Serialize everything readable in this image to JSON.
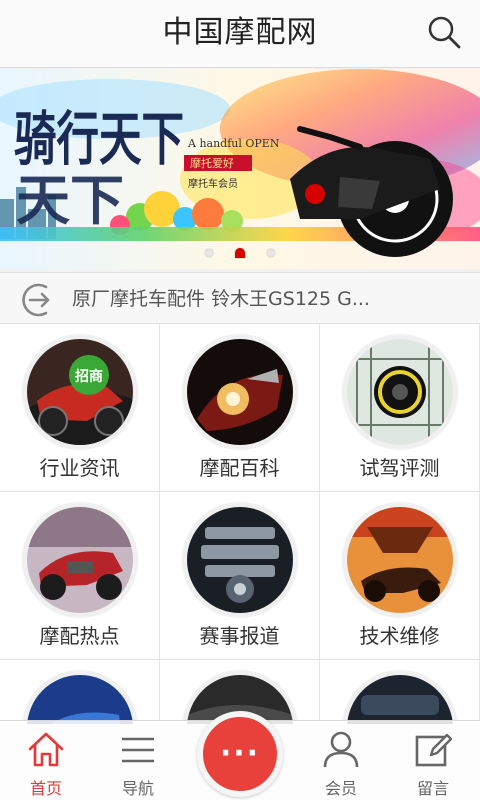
{
  "header": {
    "title": "中国摩配网",
    "search_icon": "search-icon"
  },
  "banner": {
    "big_text": "骑行天下",
    "tagline_en": "A handful OPEN",
    "tag_red": "摩托爱好",
    "tag_member": "摩托车会员",
    "slides_total": 3,
    "slide_active": 2
  },
  "ticker": {
    "icon": "arrow-right-circle-icon",
    "text": "原厂摩托车配件 铃木王GS125 G..."
  },
  "grid": {
    "items": [
      {
        "label": "行业资讯",
        "badge": "招商"
      },
      {
        "label": "摩配百科"
      },
      {
        "label": "试驾评测"
      },
      {
        "label": "摩配热点"
      },
      {
        "label": "赛事报道"
      },
      {
        "label": "技术维修"
      },
      {
        "label": ""
      },
      {
        "label": ""
      },
      {
        "label": ""
      }
    ]
  },
  "tabbar": {
    "tabs": [
      {
        "label": "首页",
        "icon": "home-icon",
        "active": true
      },
      {
        "label": "导航",
        "icon": "menu-icon"
      },
      {
        "label": "会员",
        "icon": "user-icon"
      },
      {
        "label": "留言",
        "icon": "edit-icon"
      }
    ],
    "fab_icon": "more-dots-icon",
    "fab_text": "···"
  },
  "colors": {
    "accent_red": "#e03a3a",
    "fab_red": "#e8403a"
  }
}
